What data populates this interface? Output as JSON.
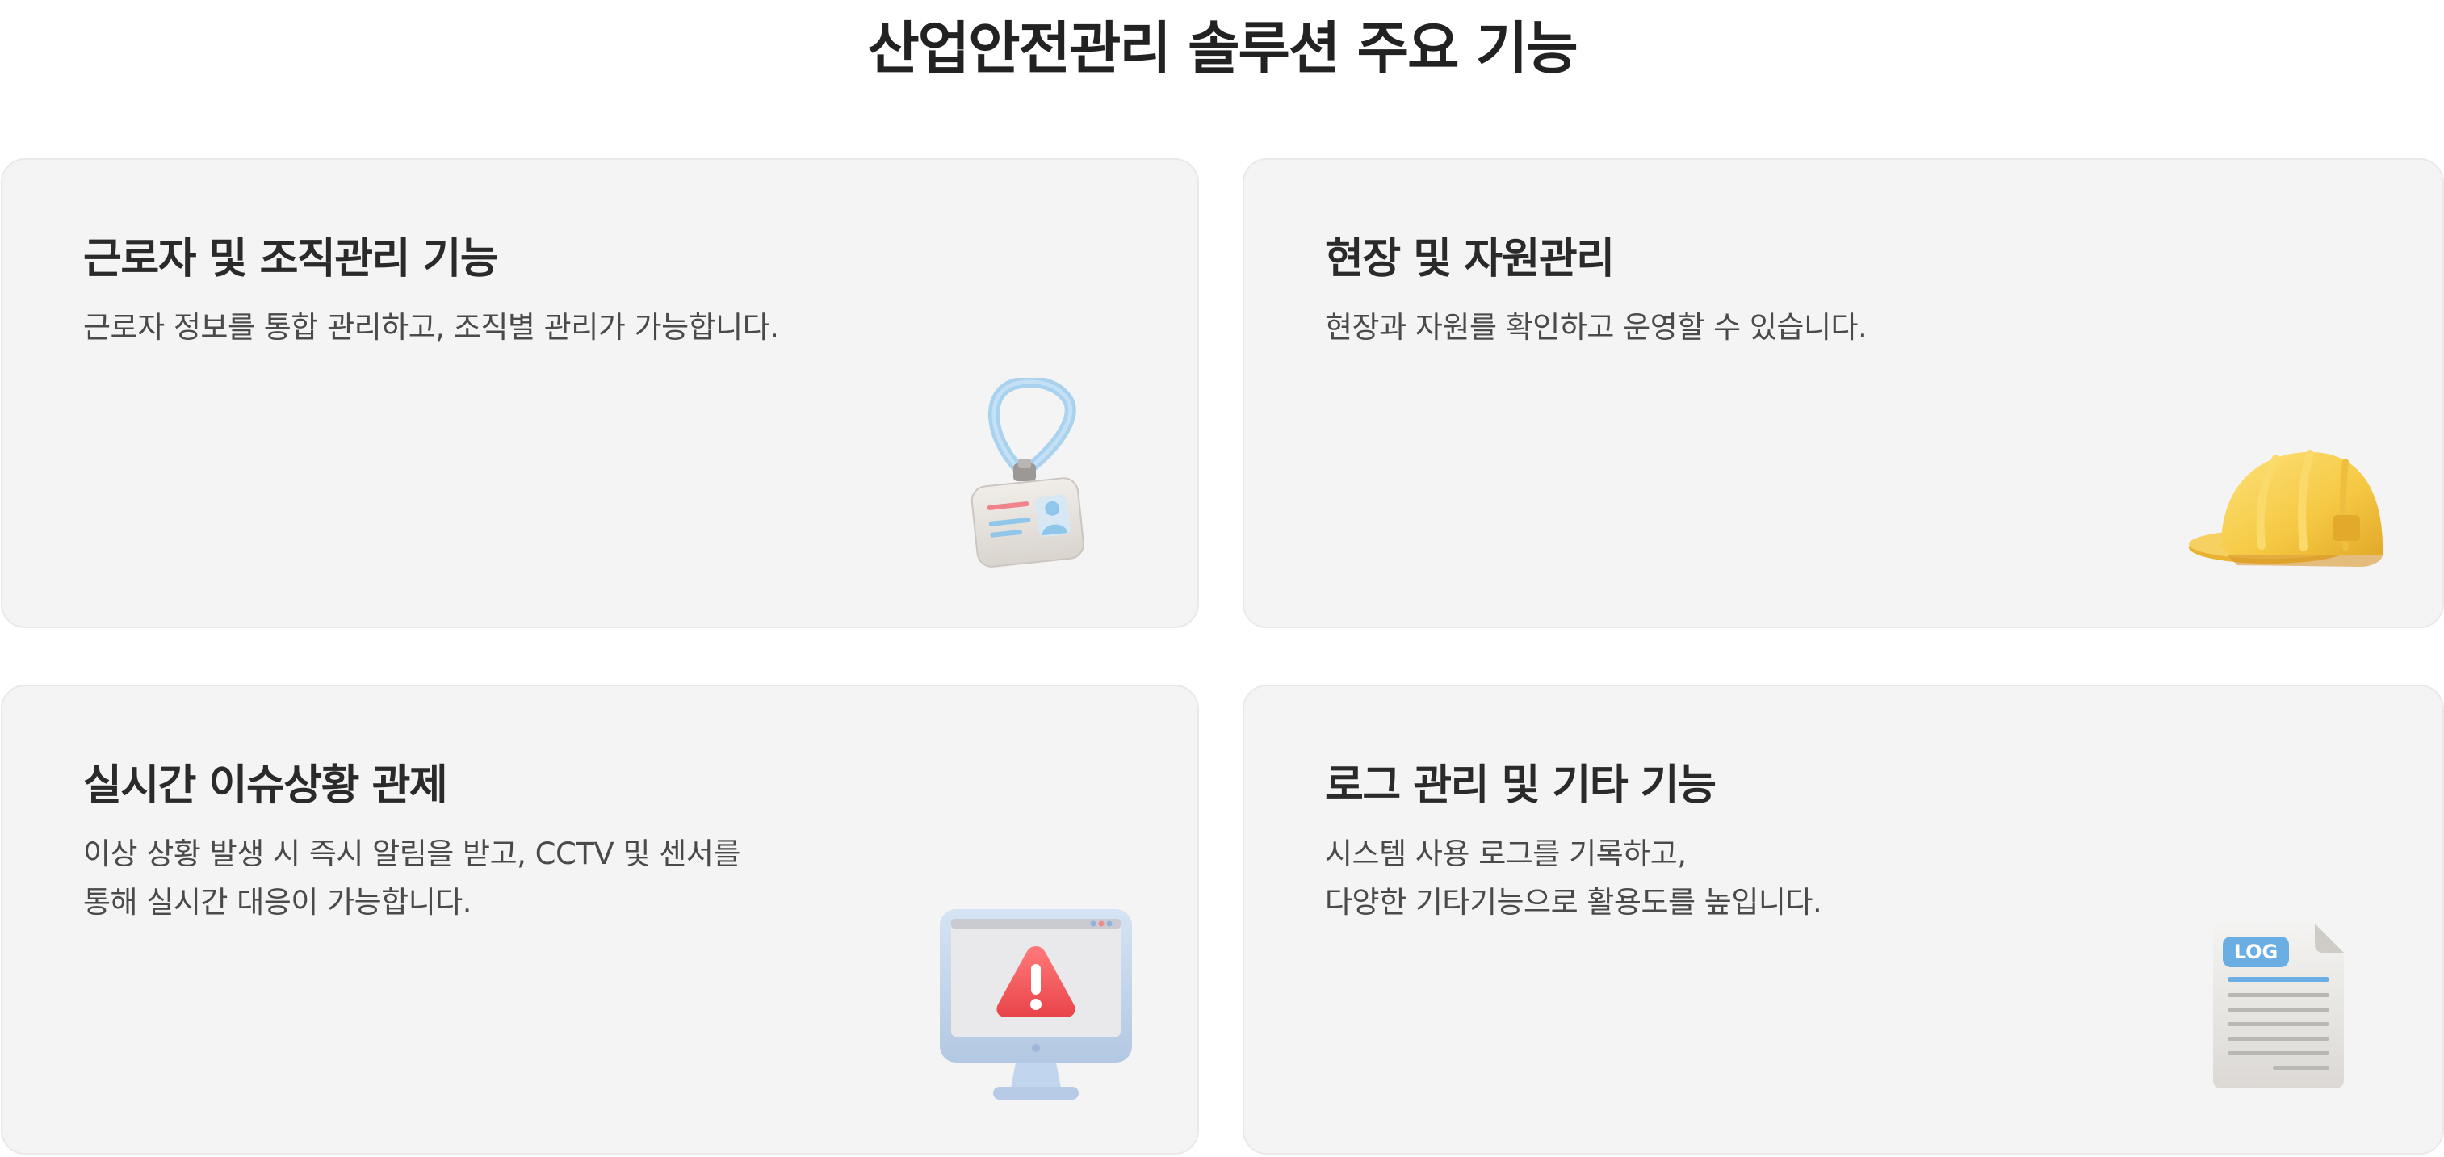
{
  "page": {
    "title": "산업안전관리 솔루션 주요 기능"
  },
  "features": [
    {
      "title": "근로자 및 조직관리 기능",
      "desc_lines": [
        "근로자 정보를 통합 관리하고, 조직별 관리가 가능합니다."
      ],
      "icon": "id-badge-icon"
    },
    {
      "title": "현장 및 자원관리",
      "desc_lines": [
        "현장과 자원를 확인하고 운영할 수 있습니다."
      ],
      "icon": "hard-hat-icon"
    },
    {
      "title": "실시간 이슈상황 관제",
      "desc_lines": [
        "이상 상황 발생 시 즉시 알림을 받고, CCTV 및 센서를",
        "통해 실시간 대응이 가능합니다."
      ],
      "icon": "monitor-warning-icon"
    },
    {
      "title": "로그 관리 및 기타 기능",
      "desc_lines": [
        "시스템 사용 로그를 기록하고,",
        "다양한 기타기능으로 활용도를 높입니다."
      ],
      "icon": "log-file-icon",
      "icon_label": "LOG"
    }
  ],
  "colors": {
    "card_background": "#f4f4f4",
    "title_text": "#222222",
    "body_text": "#4a4a4a",
    "helmet": "#f5c842",
    "warning": "#f05a5a",
    "badge_lanyard": "#a9d2ef"
  }
}
